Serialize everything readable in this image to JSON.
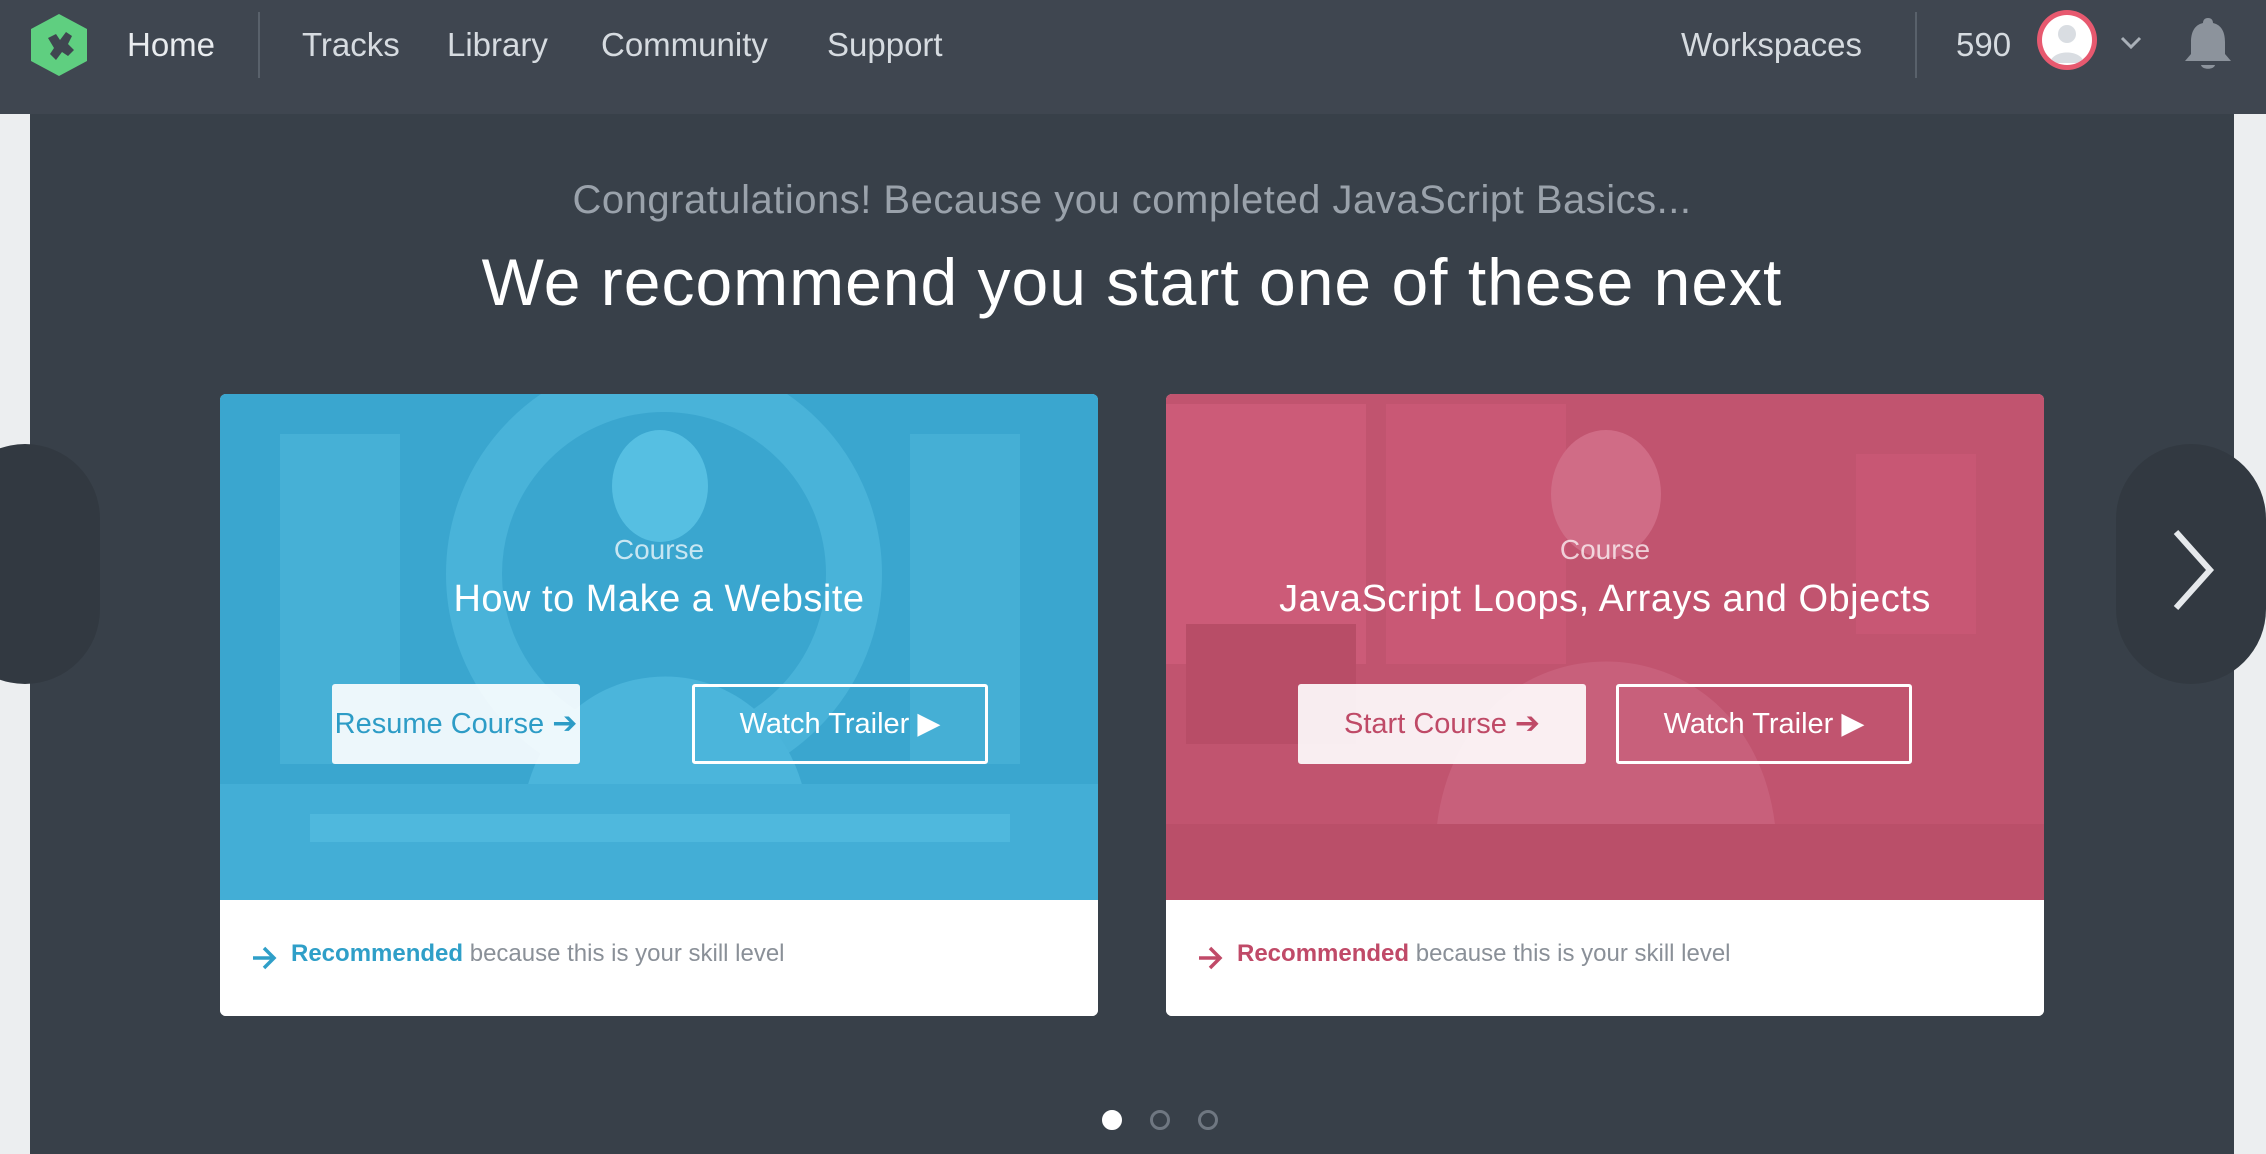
{
  "nav": {
    "home": "Home",
    "links": [
      "Tracks",
      "Library",
      "Community",
      "Support"
    ],
    "workspaces": "Workspaces",
    "points": "590",
    "icons": {
      "logo": "treehouse-frog-logo",
      "avatar": "user-avatar",
      "menu": "chevron-down-icon",
      "notifications": "bell-icon"
    },
    "colors": {
      "background": "#3f4650",
      "logo": "#5fcf80",
      "avatar_ring": "#e7596f"
    }
  },
  "hero": {
    "kicker": "Congratulations! Because you completed JavaScript Basics...",
    "headline": "We recommend you start one of these next",
    "cards": [
      {
        "tag": "Course",
        "title": "How to Make a Website",
        "primary_label": "Resume Course",
        "secondary_label": "Watch Trailer",
        "reason_strong": "Recommended",
        "reason_rest": " because this is your skill level",
        "color": "#3aa6cf"
      },
      {
        "tag": "Course",
        "title": "JavaScript Loops, Arrays and Objects",
        "primary_label": "Start Course",
        "secondary_label": "Watch Trailer",
        "reason_strong": "Recommended",
        "reason_rest": " because this is your skill level",
        "color": "#c1546f"
      }
    ],
    "carousel": {
      "pages": 3,
      "active_page": 1
    }
  }
}
